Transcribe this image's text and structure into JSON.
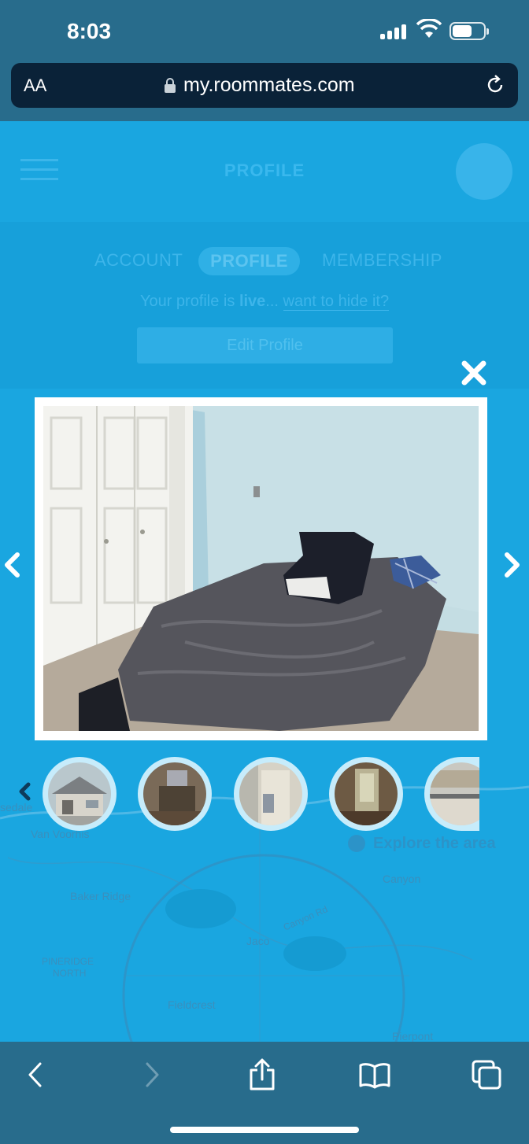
{
  "status_bar": {
    "time": "8:03",
    "battery_level": 0.55
  },
  "browser": {
    "font_size_button": "AA",
    "url": "my.roommates.com"
  },
  "app": {
    "title": "PROFILE",
    "tabs": [
      {
        "label": "ACCOUNT",
        "active": false
      },
      {
        "label": "PROFILE",
        "active": true
      },
      {
        "label": "MEMBERSHIP",
        "active": false
      }
    ],
    "live_prefix": "Your profile is ",
    "live_word": "live",
    "live_ellipsis": "... ",
    "hide_link": "want to hide it?",
    "edit_button": "Edit Profile"
  },
  "map": {
    "labels": [
      "sedale",
      "Van Voorhis",
      "Baker Ridge",
      "Canyon",
      "Canyon Rd",
      "Jaco",
      "PINERIDGE",
      "NORTH",
      "Fieldcrest",
      "Pierpont"
    ],
    "explore_button": "Explore the area"
  },
  "gallery": {
    "current_photo": "bedroom with gray comforter",
    "thumbnails": [
      "house exterior",
      "living room",
      "doorway",
      "hallway",
      "kitchen"
    ],
    "colors": {
      "frame": "#ffffff",
      "thumb_ring": "#c7ecfb",
      "overlay": "#1aa6e0"
    }
  },
  "toolbar": {
    "icons": [
      "back-icon",
      "forward-icon",
      "share-icon",
      "bookmarks-icon",
      "tabs-icon"
    ]
  }
}
